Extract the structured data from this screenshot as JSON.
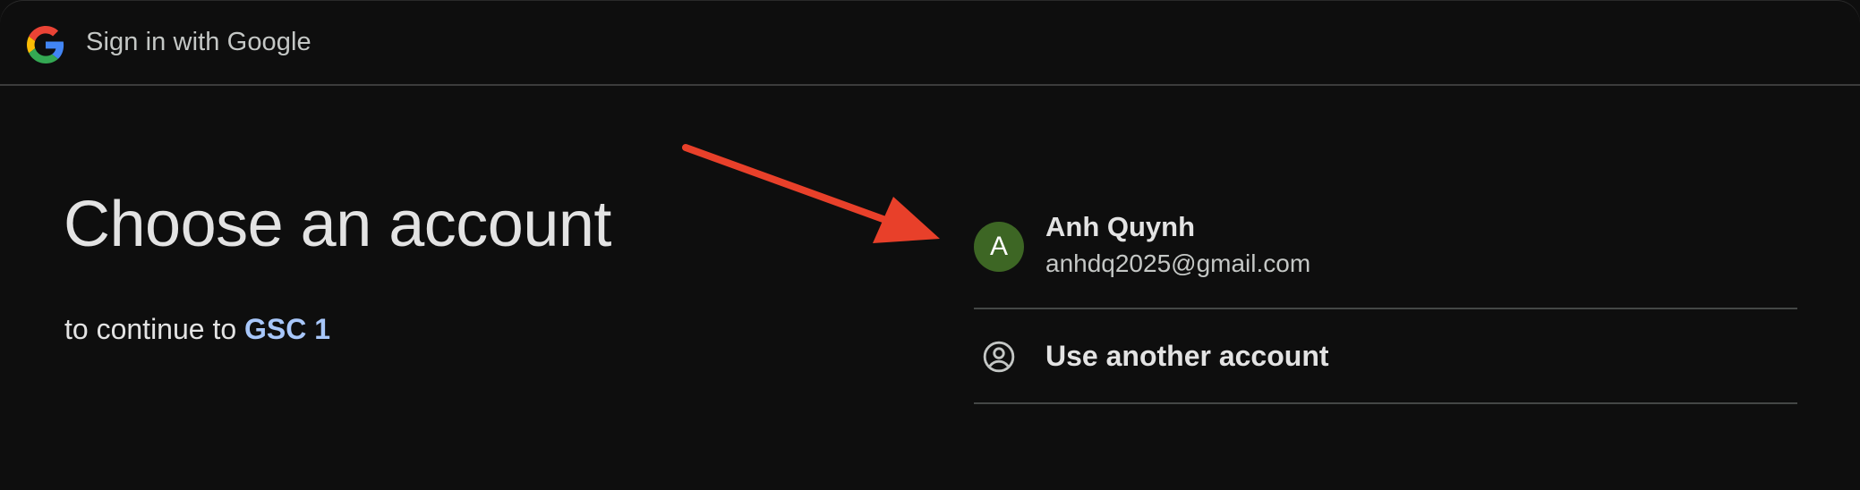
{
  "header": {
    "logo_icon": "google-g-icon",
    "title": "Sign in with Google"
  },
  "main": {
    "heading": "Choose an account",
    "subtitle_prefix": "to continue to ",
    "app_name": "GSC 1"
  },
  "accounts": [
    {
      "avatar_letter": "A",
      "avatar_color": "#3d6624",
      "name": "Anh Quynh",
      "email": "anhdq2025@gmail.com"
    }
  ],
  "use_another": {
    "icon": "account-circle-icon",
    "label": "Use another account"
  },
  "annotation": {
    "arrow_color": "#e8402a",
    "arrow_icon": "red-arrow-annotation"
  },
  "colors": {
    "background": "#0e0e0e",
    "link": "#a8c7fa",
    "divider": "#444746"
  }
}
